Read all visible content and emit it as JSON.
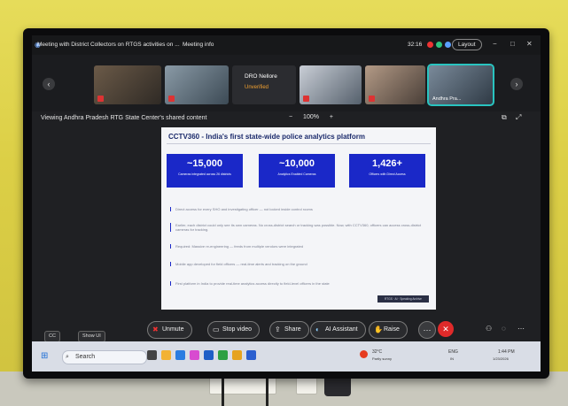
{
  "meeting": {
    "title": "Meeting with District Collectors on RTGS activities on ...",
    "info": "Meeting info",
    "clock": "32:16",
    "layout_button": "Layout"
  },
  "participants": [
    {
      "label": ""
    },
    {
      "label": ""
    },
    {
      "name": "DRO Nellore",
      "status": "Unverified"
    },
    {
      "label": ""
    },
    {
      "label": ""
    },
    {
      "label": "Andhra Pra..."
    }
  ],
  "share": {
    "viewing": "Viewing Andhra Pradesh RTG State Center's shared content",
    "zoom_out": "−",
    "zoom_level": "100%",
    "zoom_in": "+"
  },
  "slide": {
    "title": "CCTV360 - India's first state-wide police analytics platform",
    "stats": [
      {
        "value": "~15,000",
        "caption": "Cameras integrated across 26 districts"
      },
      {
        "value": "~10,000",
        "caption": "Analytics Enabled Cameras"
      },
      {
        "value": "1,426+",
        "caption": "Officers with Direct Access"
      }
    ],
    "bullets": [
      "Direct access for every SHO and investigating officer — not locked inside control rooms",
      "Earlier, each district could only see its own cameras. No cross-district search or tracking was possible. Now, with CCTV360, officers can access cross-district cameras for tracking.",
      "Required: Massive re-engineering — feeds from multiple vendors were integrated",
      "Mobile app developed for field officers — real-time alerts and tracking on the ground",
      "First platform in India to provide real-time analytics access directly to field-level officers in the state"
    ],
    "badge": "RTGS · AI · Speaking Archive"
  },
  "controls": {
    "unmute": "Unmute",
    "stop_video": "Stop video",
    "share": "Share",
    "ai_assistant": "AI Assistant",
    "raise": "Raise",
    "more": "···",
    "end": "✕"
  },
  "left_controls": {
    "cc": "CC",
    "show_ui": "Show UI"
  },
  "taskbar": {
    "search_placeholder": "Search",
    "weather": "32°C",
    "weather_sub": "Partly sunny",
    "lang": "ENG",
    "lang_sub": "IN",
    "time": "1:44 PM",
    "date": "1/23/2026"
  },
  "colors": {
    "accent": "#1a28c8",
    "end_call": "#e02a2a",
    "wall": "#dccf46"
  }
}
